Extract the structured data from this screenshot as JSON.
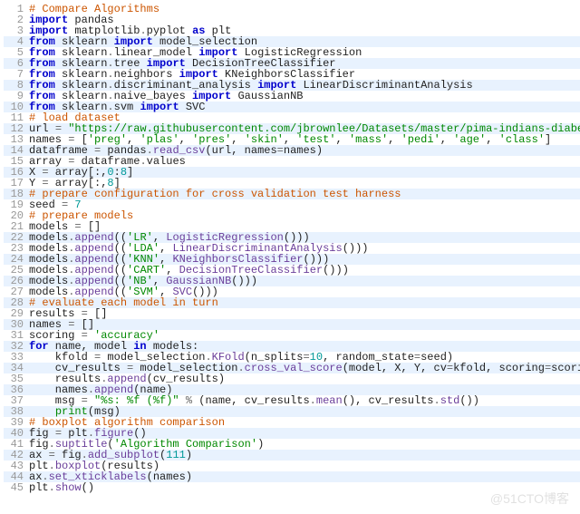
{
  "watermark": "@51CTO博客",
  "highlights": [
    4,
    6,
    8,
    10,
    12,
    14,
    16,
    18,
    22,
    24,
    26,
    28,
    30,
    32,
    34,
    36,
    38,
    40,
    42,
    44
  ],
  "code": [
    {
      "n": 1,
      "t": [
        {
          "c": "cmr",
          "v": "# Compare Algorithms"
        }
      ]
    },
    {
      "n": 2,
      "t": [
        {
          "c": "kw",
          "v": "import"
        },
        {
          "c": "nm",
          "v": " pandas"
        }
      ]
    },
    {
      "n": 3,
      "t": [
        {
          "c": "kw",
          "v": "import"
        },
        {
          "c": "nm",
          "v": " matplotlib"
        },
        {
          "c": "op",
          "v": "."
        },
        {
          "c": "nm",
          "v": "pyplot "
        },
        {
          "c": "kw",
          "v": "as"
        },
        {
          "c": "nm",
          "v": " plt"
        }
      ]
    },
    {
      "n": 4,
      "t": [
        {
          "c": "kw",
          "v": "from"
        },
        {
          "c": "nm",
          "v": " sklearn "
        },
        {
          "c": "kw",
          "v": "import"
        },
        {
          "c": "nm",
          "v": " model_selection"
        }
      ]
    },
    {
      "n": 5,
      "t": [
        {
          "c": "kw",
          "v": "from"
        },
        {
          "c": "nm",
          "v": " sklearn"
        },
        {
          "c": "op",
          "v": "."
        },
        {
          "c": "nm",
          "v": "linear_model "
        },
        {
          "c": "kw",
          "v": "import"
        },
        {
          "c": "nm",
          "v": " LogisticRegression"
        }
      ]
    },
    {
      "n": 6,
      "t": [
        {
          "c": "kw",
          "v": "from"
        },
        {
          "c": "nm",
          "v": " sklearn"
        },
        {
          "c": "op",
          "v": "."
        },
        {
          "c": "nm",
          "v": "tree "
        },
        {
          "c": "kw",
          "v": "import"
        },
        {
          "c": "nm",
          "v": " DecisionTreeClassifier"
        }
      ]
    },
    {
      "n": 7,
      "t": [
        {
          "c": "kw",
          "v": "from"
        },
        {
          "c": "nm",
          "v": " sklearn"
        },
        {
          "c": "op",
          "v": "."
        },
        {
          "c": "nm",
          "v": "neighbors "
        },
        {
          "c": "kw",
          "v": "import"
        },
        {
          "c": "nm",
          "v": " KNeighborsClassifier"
        }
      ]
    },
    {
      "n": 8,
      "t": [
        {
          "c": "kw",
          "v": "from"
        },
        {
          "c": "nm",
          "v": " sklearn"
        },
        {
          "c": "op",
          "v": "."
        },
        {
          "c": "nm",
          "v": "discriminant_analysis "
        },
        {
          "c": "kw",
          "v": "import"
        },
        {
          "c": "nm",
          "v": " LinearDiscriminantAnalysis"
        }
      ]
    },
    {
      "n": 9,
      "t": [
        {
          "c": "kw",
          "v": "from"
        },
        {
          "c": "nm",
          "v": " sklearn"
        },
        {
          "c": "op",
          "v": "."
        },
        {
          "c": "nm",
          "v": "naive_bayes "
        },
        {
          "c": "kw",
          "v": "import"
        },
        {
          "c": "nm",
          "v": " GaussianNB"
        }
      ]
    },
    {
      "n": 10,
      "t": [
        {
          "c": "kw",
          "v": "from"
        },
        {
          "c": "nm",
          "v": " sklearn"
        },
        {
          "c": "op",
          "v": "."
        },
        {
          "c": "nm",
          "v": "svm "
        },
        {
          "c": "kw",
          "v": "import"
        },
        {
          "c": "nm",
          "v": " SVC"
        }
      ]
    },
    {
      "n": 11,
      "t": [
        {
          "c": "cmr",
          "v": "# load dataset"
        }
      ]
    },
    {
      "n": 12,
      "t": [
        {
          "c": "nm",
          "v": "url "
        },
        {
          "c": "op",
          "v": "="
        },
        {
          "c": "nm",
          "v": " "
        },
        {
          "c": "str",
          "v": "\"https://raw.githubusercontent.com/jbrownlee/Datasets/master/pima-indians-diabetes.data.csv\""
        }
      ]
    },
    {
      "n": 13,
      "t": [
        {
          "c": "nm",
          "v": "names "
        },
        {
          "c": "op",
          "v": "="
        },
        {
          "c": "nm",
          "v": " ["
        },
        {
          "c": "str",
          "v": "'preg'"
        },
        {
          "c": "nm",
          "v": ", "
        },
        {
          "c": "str",
          "v": "'plas'"
        },
        {
          "c": "nm",
          "v": ", "
        },
        {
          "c": "str",
          "v": "'pres'"
        },
        {
          "c": "nm",
          "v": ", "
        },
        {
          "c": "str",
          "v": "'skin'"
        },
        {
          "c": "nm",
          "v": ", "
        },
        {
          "c": "str",
          "v": "'test'"
        },
        {
          "c": "nm",
          "v": ", "
        },
        {
          "c": "str",
          "v": "'mass'"
        },
        {
          "c": "nm",
          "v": ", "
        },
        {
          "c": "str",
          "v": "'pedi'"
        },
        {
          "c": "nm",
          "v": ", "
        },
        {
          "c": "str",
          "v": "'age'"
        },
        {
          "c": "nm",
          "v": ", "
        },
        {
          "c": "str",
          "v": "'class'"
        },
        {
          "c": "nm",
          "v": "]"
        }
      ]
    },
    {
      "n": 14,
      "t": [
        {
          "c": "nm",
          "v": "dataframe "
        },
        {
          "c": "op",
          "v": "="
        },
        {
          "c": "nm",
          "v": " pandas"
        },
        {
          "c": "op",
          "v": "."
        },
        {
          "c": "fn",
          "v": "read_csv"
        },
        {
          "c": "nm",
          "v": "(url, names"
        },
        {
          "c": "op",
          "v": "="
        },
        {
          "c": "nm",
          "v": "names)"
        }
      ]
    },
    {
      "n": 15,
      "t": [
        {
          "c": "nm",
          "v": "array "
        },
        {
          "c": "op",
          "v": "="
        },
        {
          "c": "nm",
          "v": " dataframe"
        },
        {
          "c": "op",
          "v": "."
        },
        {
          "c": "nm",
          "v": "values"
        }
      ]
    },
    {
      "n": 16,
      "t": [
        {
          "c": "nm",
          "v": "X "
        },
        {
          "c": "op",
          "v": "="
        },
        {
          "c": "nm",
          "v": " array[:,"
        },
        {
          "c": "num",
          "v": "0"
        },
        {
          "c": "nm",
          "v": ":"
        },
        {
          "c": "num",
          "v": "8"
        },
        {
          "c": "nm",
          "v": "]"
        }
      ]
    },
    {
      "n": 17,
      "t": [
        {
          "c": "nm",
          "v": "Y "
        },
        {
          "c": "op",
          "v": "="
        },
        {
          "c": "nm",
          "v": " array[:,"
        },
        {
          "c": "num",
          "v": "8"
        },
        {
          "c": "nm",
          "v": "]"
        }
      ]
    },
    {
      "n": 18,
      "t": [
        {
          "c": "cmr",
          "v": "# prepare configuration for cross validation test harness"
        }
      ]
    },
    {
      "n": 19,
      "t": [
        {
          "c": "nm",
          "v": "seed "
        },
        {
          "c": "op",
          "v": "="
        },
        {
          "c": "nm",
          "v": " "
        },
        {
          "c": "num",
          "v": "7"
        }
      ]
    },
    {
      "n": 20,
      "t": [
        {
          "c": "cmr",
          "v": "# prepare models"
        }
      ]
    },
    {
      "n": 21,
      "t": [
        {
          "c": "nm",
          "v": "models "
        },
        {
          "c": "op",
          "v": "="
        },
        {
          "c": "nm",
          "v": " []"
        }
      ]
    },
    {
      "n": 22,
      "t": [
        {
          "c": "nm",
          "v": "models"
        },
        {
          "c": "op",
          "v": "."
        },
        {
          "c": "fn",
          "v": "append"
        },
        {
          "c": "nm",
          "v": "(("
        },
        {
          "c": "str",
          "v": "'LR'"
        },
        {
          "c": "nm",
          "v": ", "
        },
        {
          "c": "fn",
          "v": "LogisticRegression"
        },
        {
          "c": "nm",
          "v": "()))"
        }
      ]
    },
    {
      "n": 23,
      "t": [
        {
          "c": "nm",
          "v": "models"
        },
        {
          "c": "op",
          "v": "."
        },
        {
          "c": "fn",
          "v": "append"
        },
        {
          "c": "nm",
          "v": "(("
        },
        {
          "c": "str",
          "v": "'LDA'"
        },
        {
          "c": "nm",
          "v": ", "
        },
        {
          "c": "fn",
          "v": "LinearDiscriminantAnalysis"
        },
        {
          "c": "nm",
          "v": "()))"
        }
      ]
    },
    {
      "n": 24,
      "t": [
        {
          "c": "nm",
          "v": "models"
        },
        {
          "c": "op",
          "v": "."
        },
        {
          "c": "fn",
          "v": "append"
        },
        {
          "c": "nm",
          "v": "(("
        },
        {
          "c": "str",
          "v": "'KNN'"
        },
        {
          "c": "nm",
          "v": ", "
        },
        {
          "c": "fn",
          "v": "KNeighborsClassifier"
        },
        {
          "c": "nm",
          "v": "()))"
        }
      ]
    },
    {
      "n": 25,
      "t": [
        {
          "c": "nm",
          "v": "models"
        },
        {
          "c": "op",
          "v": "."
        },
        {
          "c": "fn",
          "v": "append"
        },
        {
          "c": "nm",
          "v": "(("
        },
        {
          "c": "str",
          "v": "'CART'"
        },
        {
          "c": "nm",
          "v": ", "
        },
        {
          "c": "fn",
          "v": "DecisionTreeClassifier"
        },
        {
          "c": "nm",
          "v": "()))"
        }
      ]
    },
    {
      "n": 26,
      "t": [
        {
          "c": "nm",
          "v": "models"
        },
        {
          "c": "op",
          "v": "."
        },
        {
          "c": "fn",
          "v": "append"
        },
        {
          "c": "nm",
          "v": "(("
        },
        {
          "c": "str",
          "v": "'NB'"
        },
        {
          "c": "nm",
          "v": ", "
        },
        {
          "c": "fn",
          "v": "GaussianNB"
        },
        {
          "c": "nm",
          "v": "()))"
        }
      ]
    },
    {
      "n": 27,
      "t": [
        {
          "c": "nm",
          "v": "models"
        },
        {
          "c": "op",
          "v": "."
        },
        {
          "c": "fn",
          "v": "append"
        },
        {
          "c": "nm",
          "v": "(("
        },
        {
          "c": "str",
          "v": "'SVM'"
        },
        {
          "c": "nm",
          "v": ", "
        },
        {
          "c": "fn",
          "v": "SVC"
        },
        {
          "c": "nm",
          "v": "()))"
        }
      ]
    },
    {
      "n": 28,
      "t": [
        {
          "c": "cmr",
          "v": "# evaluate each model in turn"
        }
      ]
    },
    {
      "n": 29,
      "t": [
        {
          "c": "nm",
          "v": "results "
        },
        {
          "c": "op",
          "v": "="
        },
        {
          "c": "nm",
          "v": " []"
        }
      ]
    },
    {
      "n": 30,
      "t": [
        {
          "c": "nm",
          "v": "names "
        },
        {
          "c": "op",
          "v": "="
        },
        {
          "c": "nm",
          "v": " []"
        }
      ]
    },
    {
      "n": 31,
      "t": [
        {
          "c": "nm",
          "v": "scoring "
        },
        {
          "c": "op",
          "v": "="
        },
        {
          "c": "nm",
          "v": " "
        },
        {
          "c": "str",
          "v": "'accuracy'"
        }
      ]
    },
    {
      "n": 32,
      "t": [
        {
          "c": "kw",
          "v": "for"
        },
        {
          "c": "nm",
          "v": " name, model "
        },
        {
          "c": "kw",
          "v": "in"
        },
        {
          "c": "nm",
          "v": " models:"
        }
      ]
    },
    {
      "n": 33,
      "t": [
        {
          "c": "nm",
          "v": "    kfold "
        },
        {
          "c": "op",
          "v": "="
        },
        {
          "c": "nm",
          "v": " model_selection"
        },
        {
          "c": "op",
          "v": "."
        },
        {
          "c": "fn",
          "v": "KFold"
        },
        {
          "c": "nm",
          "v": "(n_splits"
        },
        {
          "c": "op",
          "v": "="
        },
        {
          "c": "num",
          "v": "10"
        },
        {
          "c": "nm",
          "v": ", random_state"
        },
        {
          "c": "op",
          "v": "="
        },
        {
          "c": "nm",
          "v": "seed)"
        }
      ]
    },
    {
      "n": 34,
      "t": [
        {
          "c": "nm",
          "v": "    cv_results "
        },
        {
          "c": "op",
          "v": "="
        },
        {
          "c": "nm",
          "v": " model_selection"
        },
        {
          "c": "op",
          "v": "."
        },
        {
          "c": "fn",
          "v": "cross_val_score"
        },
        {
          "c": "nm",
          "v": "(model, X, Y, cv"
        },
        {
          "c": "op",
          "v": "="
        },
        {
          "c": "nm",
          "v": "kfold, scoring"
        },
        {
          "c": "op",
          "v": "="
        },
        {
          "c": "nm",
          "v": "scoring)"
        }
      ]
    },
    {
      "n": 35,
      "t": [
        {
          "c": "nm",
          "v": "    results"
        },
        {
          "c": "op",
          "v": "."
        },
        {
          "c": "fn",
          "v": "append"
        },
        {
          "c": "nm",
          "v": "(cv_results)"
        }
      ]
    },
    {
      "n": 36,
      "t": [
        {
          "c": "nm",
          "v": "    names"
        },
        {
          "c": "op",
          "v": "."
        },
        {
          "c": "fn",
          "v": "append"
        },
        {
          "c": "nm",
          "v": "(name)"
        }
      ]
    },
    {
      "n": 37,
      "t": [
        {
          "c": "nm",
          "v": "    msg "
        },
        {
          "c": "op",
          "v": "="
        },
        {
          "c": "nm",
          "v": " "
        },
        {
          "c": "str",
          "v": "\"%s: %f (%f)\""
        },
        {
          "c": "nm",
          "v": " "
        },
        {
          "c": "op",
          "v": "%"
        },
        {
          "c": "nm",
          "v": " (name, cv_results"
        },
        {
          "c": "op",
          "v": "."
        },
        {
          "c": "fn",
          "v": "mean"
        },
        {
          "c": "nm",
          "v": "(), cv_results"
        },
        {
          "c": "op",
          "v": "."
        },
        {
          "c": "fn",
          "v": "std"
        },
        {
          "c": "nm",
          "v": "())"
        }
      ]
    },
    {
      "n": 38,
      "t": [
        {
          "c": "nm",
          "v": "    "
        },
        {
          "c": "bi",
          "v": "print"
        },
        {
          "c": "nm",
          "v": "(msg)"
        }
      ]
    },
    {
      "n": 39,
      "t": [
        {
          "c": "cmr",
          "v": "# boxplot algorithm comparison"
        }
      ]
    },
    {
      "n": 40,
      "t": [
        {
          "c": "nm",
          "v": "fig "
        },
        {
          "c": "op",
          "v": "="
        },
        {
          "c": "nm",
          "v": " plt"
        },
        {
          "c": "op",
          "v": "."
        },
        {
          "c": "fn",
          "v": "figure"
        },
        {
          "c": "nm",
          "v": "()"
        }
      ]
    },
    {
      "n": 41,
      "t": [
        {
          "c": "nm",
          "v": "fig"
        },
        {
          "c": "op",
          "v": "."
        },
        {
          "c": "fn",
          "v": "suptitle"
        },
        {
          "c": "nm",
          "v": "("
        },
        {
          "c": "str",
          "v": "'Algorithm Comparison'"
        },
        {
          "c": "nm",
          "v": ")"
        }
      ]
    },
    {
      "n": 42,
      "t": [
        {
          "c": "nm",
          "v": "ax "
        },
        {
          "c": "op",
          "v": "="
        },
        {
          "c": "nm",
          "v": " fig"
        },
        {
          "c": "op",
          "v": "."
        },
        {
          "c": "fn",
          "v": "add_subplot"
        },
        {
          "c": "nm",
          "v": "("
        },
        {
          "c": "num",
          "v": "111"
        },
        {
          "c": "nm",
          "v": ")"
        }
      ]
    },
    {
      "n": 43,
      "t": [
        {
          "c": "nm",
          "v": "plt"
        },
        {
          "c": "op",
          "v": "."
        },
        {
          "c": "fn",
          "v": "boxplot"
        },
        {
          "c": "nm",
          "v": "(results)"
        }
      ]
    },
    {
      "n": 44,
      "t": [
        {
          "c": "nm",
          "v": "ax"
        },
        {
          "c": "op",
          "v": "."
        },
        {
          "c": "fn",
          "v": "set_xticklabels"
        },
        {
          "c": "nm",
          "v": "(names)"
        }
      ]
    },
    {
      "n": 45,
      "t": [
        {
          "c": "nm",
          "v": "plt"
        },
        {
          "c": "op",
          "v": "."
        },
        {
          "c": "fn",
          "v": "show"
        },
        {
          "c": "nm",
          "v": "()"
        }
      ]
    }
  ]
}
